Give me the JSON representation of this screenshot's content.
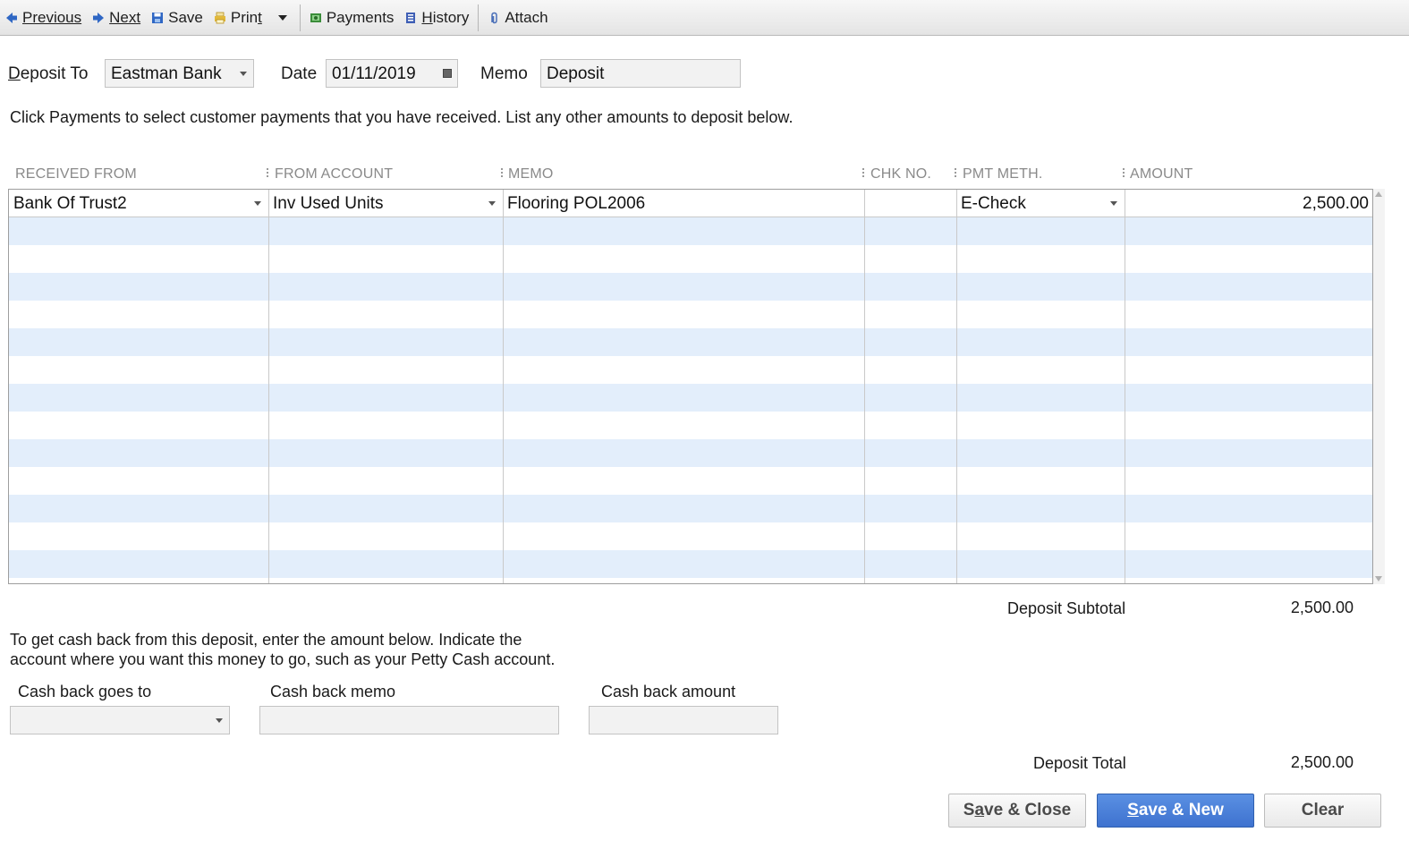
{
  "toolbar": {
    "previous": "Previous",
    "next": "Next",
    "save": "Save",
    "print": "Print",
    "payments": "Payments",
    "history": "History",
    "attach": "Attach"
  },
  "header": {
    "deposit_to_label": "Deposit To",
    "deposit_to_value": "Eastman Bank",
    "date_label": "Date",
    "date_value": "01/11/2019",
    "memo_label": "Memo",
    "memo_value": "Deposit"
  },
  "instructions": "Click Payments to select customer payments that you have received. List any other amounts to deposit below.",
  "grid": {
    "columns": [
      "RECEIVED FROM",
      "FROM ACCOUNT",
      "MEMO",
      "CHK NO.",
      "PMT METH.",
      "AMOUNT"
    ],
    "rows": [
      {
        "received_from": "Bank Of Trust2",
        "from_account": "Inv Used Units",
        "memo": "Flooring POL2006",
        "chk_no": "",
        "pmt_meth": "E-Check",
        "amount": "2,500.00"
      }
    ]
  },
  "subtotal": {
    "label": "Deposit Subtotal",
    "value": "2,500.00"
  },
  "cashback": {
    "instructions_line1": "To get cash back from this deposit, enter the amount below.  Indicate the",
    "instructions_line2": "account where you want this money to go, such as your Petty Cash account.",
    "goes_to_label": "Cash back goes to",
    "memo_label": "Cash back memo",
    "amount_label": "Cash back amount",
    "goes_to_value": "",
    "memo_value": "",
    "amount_value": ""
  },
  "total": {
    "label": "Deposit Total",
    "value": "2,500.00"
  },
  "buttons": {
    "save_close": "Save & Close",
    "save_new": "Save & New",
    "clear": "Clear"
  },
  "colors": {
    "accent": "#3e72cf",
    "row_alt": "#e3eefb"
  }
}
